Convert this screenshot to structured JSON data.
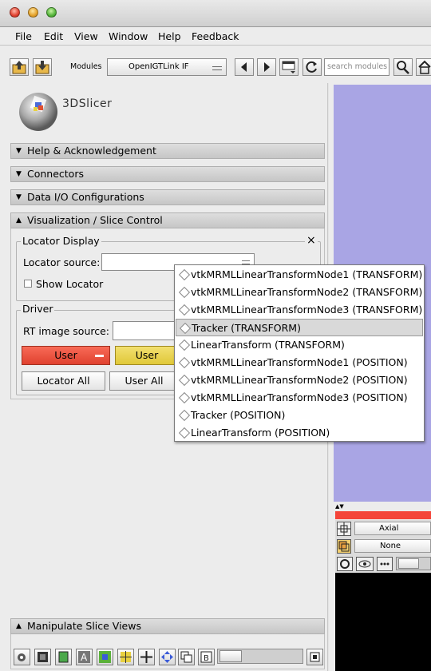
{
  "menu": [
    "File",
    "Edit",
    "View",
    "Window",
    "Help",
    "Feedback"
  ],
  "toolbar": {
    "modules_label": "Modules",
    "module_selected": "OpenIGTLink IF",
    "search_placeholder": "search modules"
  },
  "logo_text": "3DSlicer",
  "sections": {
    "help": "Help & Acknowledgement",
    "connectors": "Connectors",
    "data_io": "Data I/O Configurations",
    "visualization": "Visualization / Slice Control",
    "manipulate": "Manipulate Slice Views"
  },
  "locator_display": {
    "title": "Locator Display",
    "close": "×",
    "source_label": "Locator source:",
    "source_value": "",
    "show_locator_label": "Show Locator"
  },
  "driver": {
    "title": "Driver",
    "rt_label": "RT image source:",
    "rt_value": "",
    "user_red": "User",
    "user_yellow": "User",
    "locator_all": "Locator All",
    "user_all": "User All"
  },
  "dropdown_items": [
    "vtkMRMLLinearTransformNode1 (TRANSFORM)",
    "vtkMRMLLinearTransformNode2 (TRANSFORM)",
    "vtkMRMLLinearTransformNode3 (TRANSFORM)",
    "Tracker (TRANSFORM)",
    "LinearTransform (TRANSFORM)",
    "vtkMRMLLinearTransformNode1 (POSITION)",
    "vtkMRMLLinearTransformNode2 (POSITION)",
    "vtkMRMLLinearTransformNode3 (POSITION)",
    "Tracker (POSITION)",
    "LinearTransform (POSITION)"
  ],
  "dropdown_highlighted": "Tracker (TRANSFORM)",
  "slice_view": {
    "orientation": "Axial",
    "layer": "None"
  },
  "colors": {
    "viewer_bg": "#a9a5e4",
    "slice_red": "#f4453a",
    "user_red_btn": "#f4543f",
    "user_yellow_btn": "#ecd84a"
  }
}
